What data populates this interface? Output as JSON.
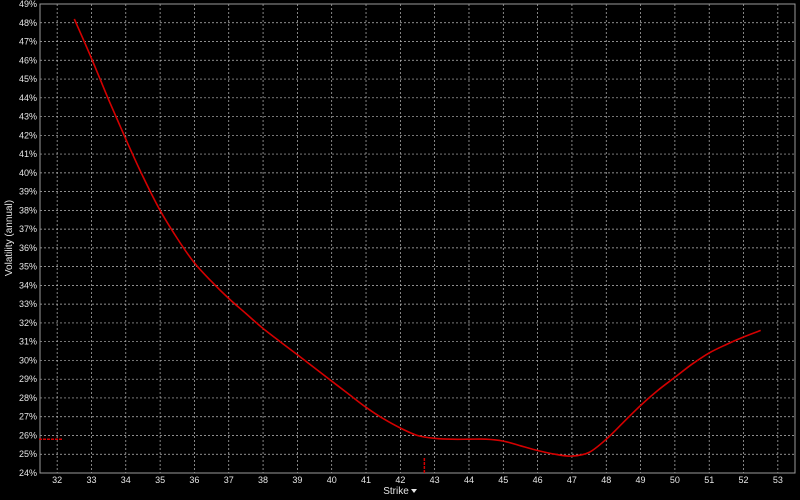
{
  "chart_data": {
    "type": "line",
    "xlabel": "Strike",
    "ylabel": "Volatility (annual)",
    "xlim": [
      31.5,
      53.5
    ],
    "ylim": [
      24,
      49
    ],
    "x_ticks": [
      "32",
      "33",
      "34",
      "35",
      "36",
      "37",
      "38",
      "39",
      "40",
      "41",
      "42",
      "43",
      "44",
      "45",
      "46",
      "47",
      "48",
      "49",
      "50",
      "51",
      "52",
      "53"
    ],
    "y_ticks": [
      "24%",
      "25%",
      "26%",
      "27%",
      "28%",
      "29%",
      "30%",
      "31%",
      "32%",
      "33%",
      "34%",
      "35%",
      "36%",
      "37%",
      "38%",
      "39%",
      "40%",
      "41%",
      "42%",
      "43%",
      "44%",
      "45%",
      "46%",
      "47%",
      "48%",
      "49%"
    ],
    "grid": true,
    "series": [
      {
        "color": "#d40000",
        "x": [
          32.5,
          33.0,
          33.5,
          34.0,
          34.5,
          35.0,
          35.5,
          36.0,
          36.5,
          37.0,
          37.5,
          38.0,
          38.5,
          39.0,
          39.5,
          40.0,
          40.5,
          41.0,
          41.5,
          42.0,
          42.5,
          43.0,
          43.5,
          44.0,
          44.5,
          45.0,
          45.5,
          46.0,
          46.5,
          47.0,
          47.5,
          48.0,
          48.5,
          49.0,
          49.5,
          50.0,
          50.5,
          51.0,
          51.5,
          52.0,
          52.5
        ],
        "y": [
          48.2,
          46.1,
          43.9,
          41.8,
          39.8,
          38.0,
          36.5,
          35.2,
          34.2,
          33.3,
          32.5,
          31.7,
          31.0,
          30.3,
          29.6,
          28.9,
          28.2,
          27.5,
          26.9,
          26.4,
          26.0,
          25.85,
          25.8,
          25.8,
          25.8,
          25.7,
          25.45,
          25.2,
          25.0,
          24.9,
          25.1,
          25.8,
          26.7,
          27.6,
          28.4,
          29.1,
          29.8,
          30.4,
          30.85,
          31.25,
          31.6
        ]
      }
    ],
    "markers": [
      {
        "type": "horizontal-tick",
        "y": 25.8
      },
      {
        "type": "vertical-tick",
        "x": 42.7
      }
    ]
  }
}
